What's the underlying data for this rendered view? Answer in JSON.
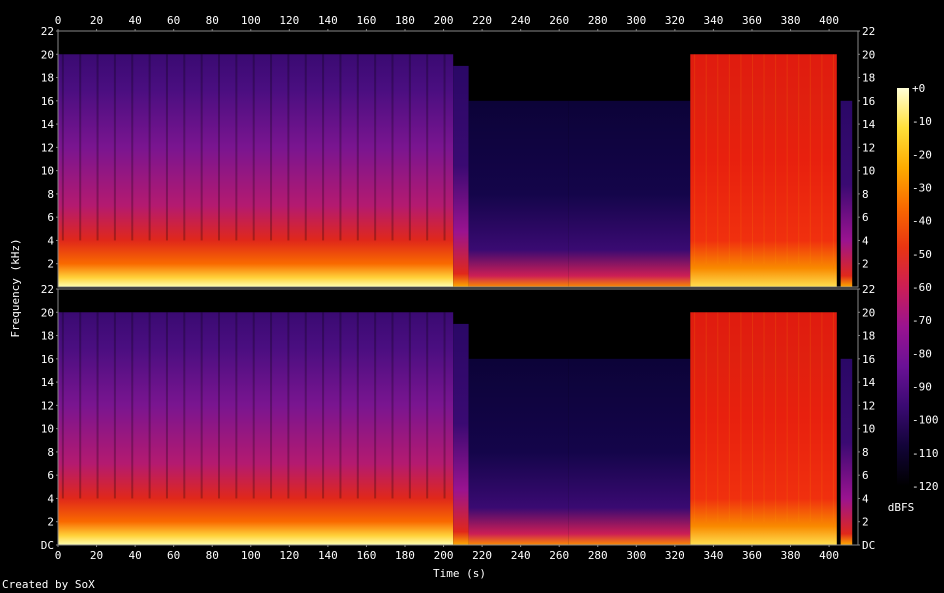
{
  "chart_data": {
    "type": "heatmap",
    "subtype": "spectrogram",
    "xlabel": "Time (s)",
    "ylabel": "Frequency (kHz)",
    "xlim": [
      0,
      415
    ],
    "ylim": [
      0,
      22
    ],
    "x_ticks": [
      0,
      20,
      40,
      60,
      80,
      100,
      120,
      140,
      160,
      180,
      200,
      220,
      240,
      260,
      280,
      300,
      320,
      340,
      360,
      380,
      400
    ],
    "y_ticks": [
      "DC",
      "2",
      "4",
      "6",
      "8",
      "10",
      "12",
      "14",
      "16",
      "18",
      "20",
      "22"
    ],
    "y_ticks_top_channel": [
      "2",
      "4",
      "6",
      "8",
      "10",
      "12",
      "14",
      "16",
      "18",
      "20",
      "22"
    ],
    "channels": 2,
    "colorbar": {
      "label": "dBFS",
      "ticks": [
        "+0",
        "-10",
        "-20",
        "-30",
        "-40",
        "-50",
        "-60",
        "-70",
        "-80",
        "-90",
        "-100",
        "-110",
        "-120"
      ],
      "range": [
        -120,
        0
      ],
      "colors": [
        "#000000",
        "#120438",
        "#3a0a72",
        "#6a1196",
        "#9a1390",
        "#cc1e55",
        "#e93512",
        "#f96a00",
        "#fdab00",
        "#ffe03a",
        "#ffffd8"
      ]
    },
    "segments": [
      {
        "start_s": 0,
        "end_s": 205,
        "max_freq_khz": 20,
        "intensity_dbfs": -55
      },
      {
        "start_s": 205,
        "end_s": 213,
        "max_freq_khz": 19,
        "intensity_dbfs": -85
      },
      {
        "start_s": 213,
        "end_s": 265,
        "max_freq_khz": 16,
        "intensity_dbfs": -105
      },
      {
        "start_s": 265,
        "end_s": 328,
        "max_freq_khz": 16,
        "intensity_dbfs": -95
      },
      {
        "start_s": 328,
        "end_s": 404,
        "max_freq_khz": 20,
        "intensity_dbfs": -50
      },
      {
        "start_s": 406,
        "end_s": 412,
        "max_freq_khz": 16,
        "intensity_dbfs": -75
      }
    ]
  },
  "footer": {
    "credit": "Created by SoX"
  }
}
